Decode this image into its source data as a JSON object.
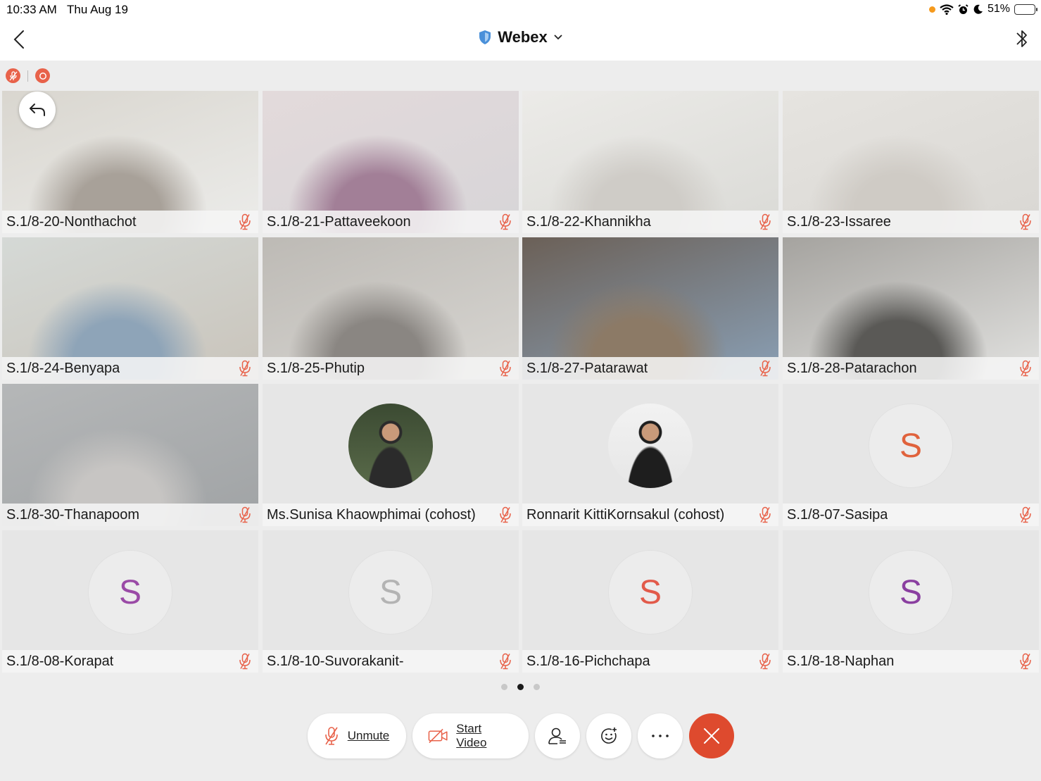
{
  "status_bar": {
    "time": "10:33 AM",
    "date": "Thu Aug 19",
    "battery": "51%",
    "battery_level": 0.51,
    "icons": [
      "orange-dot-icon",
      "wifi-icon",
      "alarm-icon",
      "moon-icon",
      "battery-charging-icon"
    ]
  },
  "nav": {
    "title": "Webex",
    "back_icon": "chevron-left-icon",
    "shield_icon": "shield-icon",
    "dropdown_icon": "chevron-down-icon",
    "bluetooth_icon": "bluetooth-icon"
  },
  "indicators": {
    "items": [
      "muted-mic-icon",
      "recording-icon"
    ],
    "color": "#e8624a"
  },
  "participants": [
    {
      "name": "S.1/8-20-Nonthachot",
      "type": "video",
      "scene": [
        "#a8a199",
        "#d9d6cf",
        "#ececea"
      ]
    },
    {
      "name": "S.1/8-21-Pattaveekoon",
      "type": "video",
      "scene": [
        "#a27f97",
        "#e3dadb",
        "#d7d5d8"
      ]
    },
    {
      "name": "S.1/8-22-Khannikha",
      "type": "video",
      "scene": [
        "#cfccc7",
        "#ecebe8",
        "#dadad6"
      ]
    },
    {
      "name": "S.1/8-23-Issaree",
      "type": "video",
      "scene": [
        "#cfcbc5",
        "#e6e4e0",
        "#d9d7d3"
      ]
    },
    {
      "name": "S.1/8-24-Benyapa",
      "type": "video",
      "scene": [
        "#8ea4b8",
        "#d5d9d6",
        "#c9c4bb"
      ]
    },
    {
      "name": "S.1/8-25-Phutip",
      "type": "video",
      "scene": [
        "#8a8682",
        "#bdbab5",
        "#d8d6d2"
      ]
    },
    {
      "name": "S.1/8-27-Patarawat",
      "type": "video",
      "scene": [
        "#8c7a66",
        "#6b6057",
        "#8aa0b6"
      ]
    },
    {
      "name": "S.1/8-28-Patarachon",
      "type": "video",
      "scene": [
        "#5a5956",
        "#a5a39f",
        "#e2e2e0"
      ]
    },
    {
      "name": "S.1/8-30-Thanapoom",
      "type": "video",
      "scene": [
        "#c7c5c3",
        "#b5b7b8",
        "#a0a3a5"
      ]
    },
    {
      "name": "Ms.Sunisa Khaowphimai (cohost)",
      "type": "photo",
      "scene": [
        "#3b4a32",
        "#5a6b4a",
        "#2b2b2b"
      ]
    },
    {
      "name": "Ronnarit KittiKornsakul (cohost)",
      "type": "photo",
      "scene": [
        "#f2f2f2",
        "#e6e6e6",
        "#1e1e1e"
      ]
    },
    {
      "name": "S.1/8-07-Sasipa",
      "type": "initial",
      "initial": "S",
      "color": "#e0623c"
    },
    {
      "name": "S.1/8-08-Korapat",
      "type": "initial",
      "initial": "S",
      "color": "#9a4aa6"
    },
    {
      "name": "S.1/8-10-Suvorakanit-",
      "type": "initial",
      "initial": "S",
      "color": "#b3b3b3"
    },
    {
      "name": "S.1/8-16-Pichchapa",
      "type": "initial",
      "initial": "S",
      "color": "#e25a4a"
    },
    {
      "name": "S.1/8-18-Naphan",
      "type": "initial",
      "initial": "S",
      "color": "#8a3fa0"
    }
  ],
  "share_back_icon": "reply-arrow-icon",
  "mic_color": "#e8624a",
  "pager": {
    "pages": 3,
    "active": 1
  },
  "controls": {
    "unmute_label": "Unmute",
    "start_video_label": "Start Video",
    "participants_icon": "participants-icon",
    "reactions_icon": "smiley-icon",
    "more_icon": "more-icon",
    "end_icon": "close-icon",
    "end_color": "#de4a2e"
  }
}
